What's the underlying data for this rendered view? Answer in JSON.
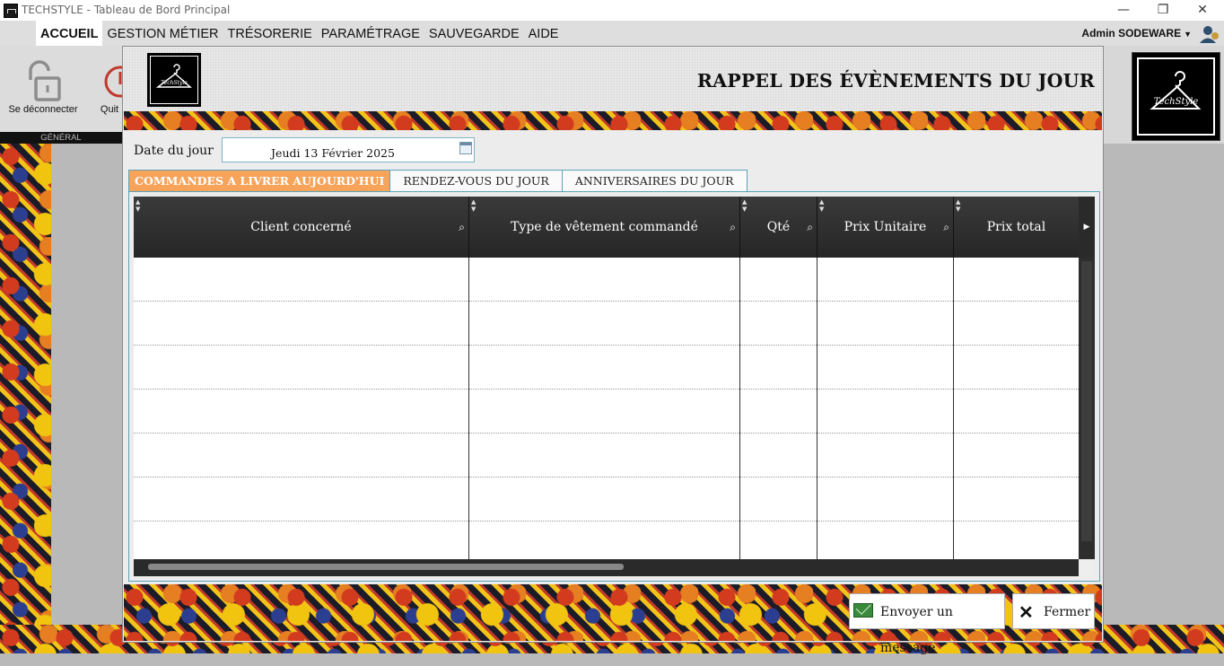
{
  "window": {
    "title": "TECHSTYLE - Tableau de Bord Principal",
    "minimize": "—",
    "restore": "❐",
    "close": "✕"
  },
  "menu": {
    "items": [
      "ACCUEIL",
      "GESTION MÉTIER",
      "TRÉSORERIE",
      "PARAMÉTRAGE",
      "SAUVEGARDE",
      "AIDE"
    ],
    "active": "ACCUEIL"
  },
  "user": {
    "name": "Admin SODEWARE"
  },
  "ribbon": {
    "logout_label": "Se déconnecter",
    "quit_label": "Quit",
    "group_label": "GÉNÉRAL"
  },
  "logo": {
    "text": "TechStyle"
  },
  "dialog": {
    "title": "RAPPEL DES ÉVÈNEMENTS DU JOUR",
    "date_label": "Date du jour",
    "date_value": "Jeudi 13 Février 2025",
    "tabs": [
      "COMMANDES A LIVRER AUJOURD'HUI",
      "RENDEZ-VOUS DU JOUR",
      "ANNIVERSAIRES DU JOUR"
    ],
    "active_tab": 0,
    "table": {
      "columns": [
        "Client concerné",
        "Type de vêtement commandé",
        "Qté",
        "Prix Unitaire",
        "Prix total"
      ],
      "rows": []
    },
    "send_button": "Envoyer un message",
    "close_button": "Fermer"
  },
  "colors": {
    "accent_tab": "#f7a35a",
    "tab_border": "#5ba3b8",
    "grid_header": "#2b2b2b"
  }
}
